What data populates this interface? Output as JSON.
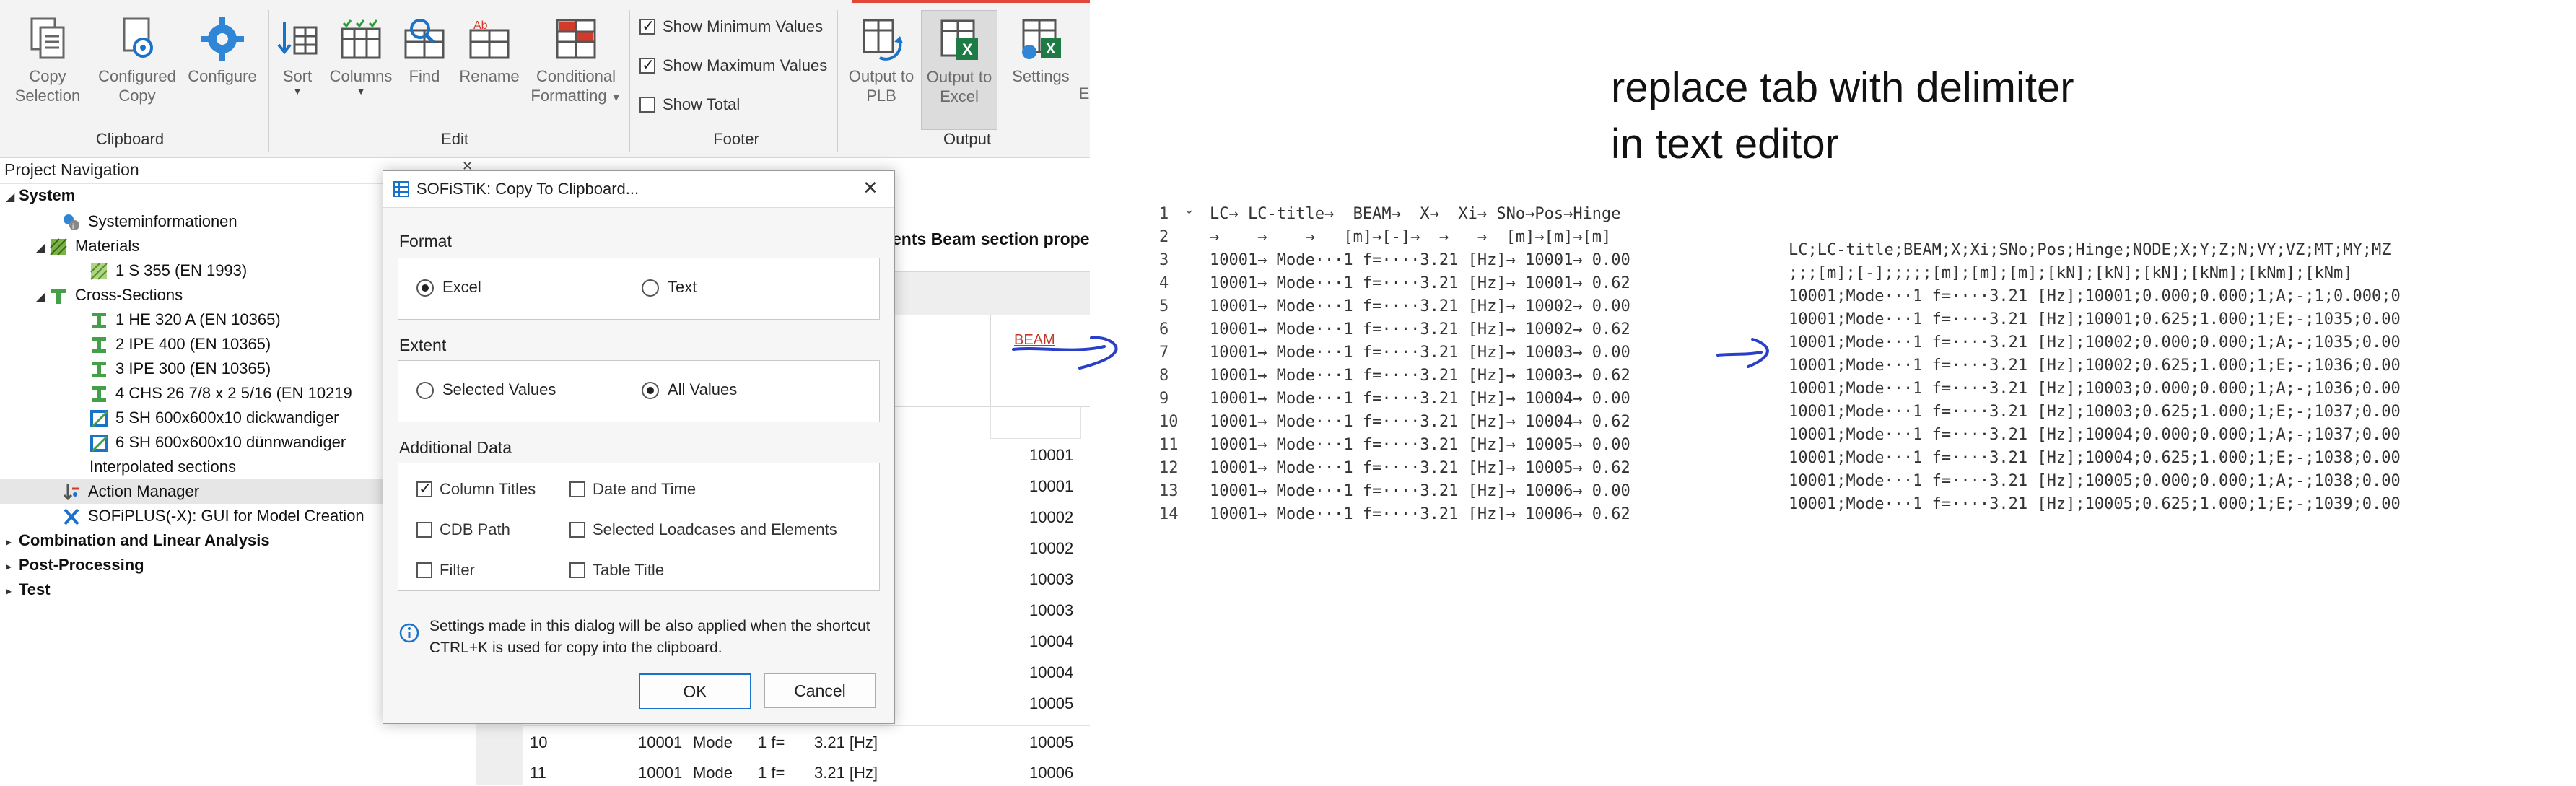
{
  "ribbon": {
    "clipboard": {
      "copy_selection": "Copy Selection",
      "configured_copy": "Configured Copy",
      "configure": "Configure",
      "group": "Clipboard"
    },
    "edit": {
      "sort": "Sort",
      "columns": "Columns",
      "find": "Find",
      "rename": "Rename",
      "conditional_formatting": "Conditional Formatting",
      "group": "Edit"
    },
    "footer": {
      "show_min": "Show Minimum Values",
      "show_max": "Show Maximum Values",
      "show_total": "Show Total",
      "group": "Footer",
      "show_min_checked": true,
      "show_max_checked": true,
      "show_total_checked": false
    },
    "output": {
      "output_plb": "Output to PLB",
      "output_excel": "Output to Excel",
      "settings": "Settings",
      "partial": "E",
      "group": "Output"
    }
  },
  "project_navigation": {
    "title": "Project Navigation",
    "tree": [
      {
        "label": "System",
        "bold": true
      },
      {
        "label": "Systeminformationen"
      },
      {
        "label": "Materials"
      },
      {
        "label": "1 S 355 (EN 1993)"
      },
      {
        "label": "Cross-Sections"
      },
      {
        "label": "1 HE 320 A (EN 10365)"
      },
      {
        "label": "2 IPE 400 (EN 10365)"
      },
      {
        "label": "3 IPE 300 (EN 10365)"
      },
      {
        "label": "4 CHS 26 7/8 x 2 5/16 (EN 10219"
      },
      {
        "label": "5 SH 600x600x10 dickwandiger"
      },
      {
        "label": "6 SH 600x600x10 dünnwandiger"
      },
      {
        "label": "Interpolated sections"
      },
      {
        "label": "Action Manager"
      },
      {
        "label": "SOFiPLUS(-X): GUI for Model Creation"
      },
      {
        "label": "Combination and Linear Analysis",
        "bold": true
      },
      {
        "label": "Post-Processing",
        "bold": true
      },
      {
        "label": "Test",
        "bold": true
      }
    ]
  },
  "table": {
    "title_fragment": "ents Beam section prope",
    "header_beam": "BEAM",
    "beam_values": [
      "10001",
      "10001",
      "10002",
      "10002",
      "10003",
      "10003",
      "10004",
      "10004",
      "10005"
    ],
    "rows": [
      {
        "no": "10",
        "lc": "10001",
        "title": "Mode",
        "n": "1 f=",
        "val": "3.21 [Hz]",
        "beam": "10005"
      },
      {
        "no": "11",
        "lc": "10001",
        "title": "Mode",
        "n": "1 f=",
        "val": "3.21 [Hz]",
        "beam": "10006"
      }
    ]
  },
  "dialog": {
    "title": "SOFiSTiK: Copy To Clipboard...",
    "format_label": "Format",
    "format_excel": "Excel",
    "format_text": "Text",
    "extent_label": "Extent",
    "extent_selected": "Selected Values",
    "extent_all": "All Values",
    "additional_label": "Additional Data",
    "column_titles": "Column Titles",
    "date_time": "Date and Time",
    "cdb_path": "CDB Path",
    "selected_loadcases": "Selected Loadcases and Elements",
    "filter": "Filter",
    "table_title": "Table Title",
    "info": "Settings made in this dialog will be also applied when the shortcut CTRL+K is used for copy into the clipboard.",
    "ok": "OK",
    "cancel": "Cancel"
  },
  "annotation": {
    "line1": "replace tab with delimiter",
    "line2": "in text  editor"
  },
  "editor_left": {
    "line_numbers": [
      "1",
      "2",
      "3",
      "4",
      "5",
      "6",
      "7",
      "8",
      "9",
      "10",
      "11",
      "12",
      "13",
      "14"
    ],
    "lines": [
      "LC→ LC-title→  BEAM→  X→  Xi→ SNo→Pos→Hinge",
      "→    →    →   [m]→[-]→  →   →  [m]→[m]→[m]",
      "10001→ Mode···1 f=····3.21 [Hz]→ 10001→ 0.00",
      "10001→ Mode···1 f=····3.21 [Hz]→ 10001→ 0.62",
      "10001→ Mode···1 f=····3.21 [Hz]→ 10002→ 0.00",
      "10001→ Mode···1 f=····3.21 [Hz]→ 10002→ 0.62",
      "10001→ Mode···1 f=····3.21 [Hz]→ 10003→ 0.00",
      "10001→ Mode···1 f=····3.21 [Hz]→ 10003→ 0.62",
      "10001→ Mode···1 f=····3.21 [Hz]→ 10004→ 0.00",
      "10001→ Mode···1 f=····3.21 [Hz]→ 10004→ 0.62",
      "10001→ Mode···1 f=····3.21 [Hz]→ 10005→ 0.00",
      "10001→ Mode···1 f=····3.21 [Hz]→ 10005→ 0.62",
      "10001→ Mode···1 f=····3.21 [Hz]→ 10006→ 0.00",
      "10001→ Mode···1 f=····3.21 [Hz]→ 10006→ 0.62"
    ]
  },
  "editor_right": {
    "lines": [
      "LC;LC-title;BEAM;X;Xi;SNo;Pos;Hinge;NODE;X;Y;Z;N;VY;VZ;MT;MY;MZ",
      ";;;[m];[-];;;;;[m];[m];[m];[kN];[kN];[kN];[kNm];[kNm];[kNm]",
      "10001;Mode···1 f=····3.21 [Hz];10001;0.000;0.000;1;A;-;1;0.000;0",
      "10001;Mode···1 f=····3.21 [Hz];10001;0.625;1.000;1;E;-;1035;0.00",
      "10001;Mode···1 f=····3.21 [Hz];10002;0.000;0.000;1;A;-;1035;0.00",
      "10001;Mode···1 f=····3.21 [Hz];10002;0.625;1.000;1;E;-;1036;0.00",
      "10001;Mode···1 f=····3.21 [Hz];10003;0.000;0.000;1;A;-;1036;0.00",
      "10001;Mode···1 f=····3.21 [Hz];10003;0.625;1.000;1;E;-;1037;0.00",
      "10001;Mode···1 f=····3.21 [Hz];10004;0.000;0.000;1;A;-;1037;0.00",
      "10001;Mode···1 f=····3.21 [Hz];10004;0.625;1.000;1;E;-;1038;0.00",
      "10001;Mode···1 f=····3.21 [Hz];10005;0.000;0.000;1;A;-;1038;0.00",
      "10001;Mode···1 f=····3.21 [Hz];10005;0.625;1.000;1;E;-;1039;0.00"
    ]
  },
  "colors": {
    "accent_blue": "#1a73c8",
    "ink_blue": "#2a3fc8",
    "beam_red": "#c0392b"
  }
}
